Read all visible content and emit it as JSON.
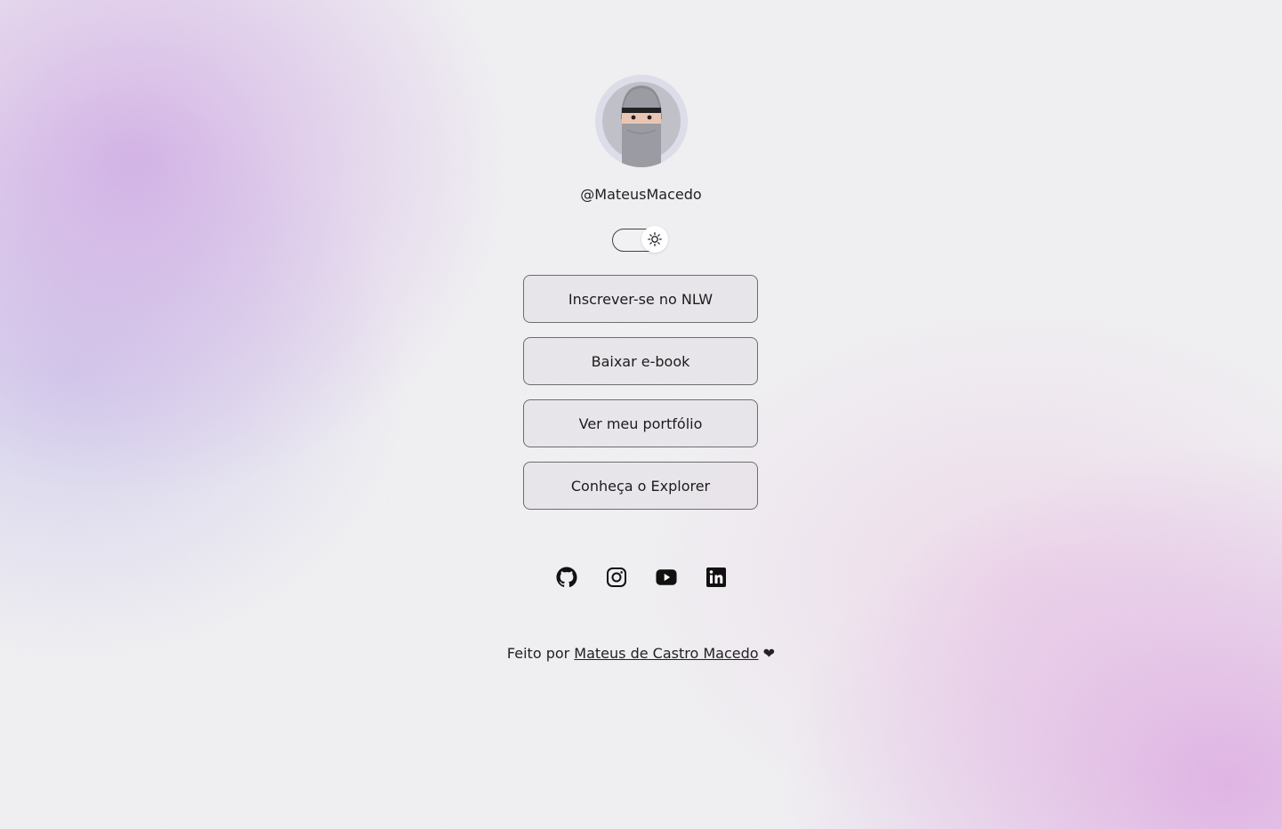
{
  "profile": {
    "username": "@MateusMacedo",
    "avatar_icon": "ninja-avatar-icon"
  },
  "theme_switch": {
    "icon": "sun-icon"
  },
  "links": [
    {
      "label": "Inscrever-se no NLW"
    },
    {
      "label": "Baixar e-book"
    },
    {
      "label": "Ver meu portfólio"
    },
    {
      "label": "Conheça o Explorer"
    }
  ],
  "social": [
    {
      "icon": "github-icon"
    },
    {
      "icon": "instagram-icon"
    },
    {
      "icon": "youtube-icon"
    },
    {
      "icon": "linkedin-icon"
    }
  ],
  "footer": {
    "prefix": "Feito por ",
    "author": "Mateus de Castro Macedo",
    "heart": "❤"
  },
  "colors": {
    "accent_purple": "#cca0e4",
    "background": "#f2f1f4",
    "button_border": "#6d6d6d"
  }
}
